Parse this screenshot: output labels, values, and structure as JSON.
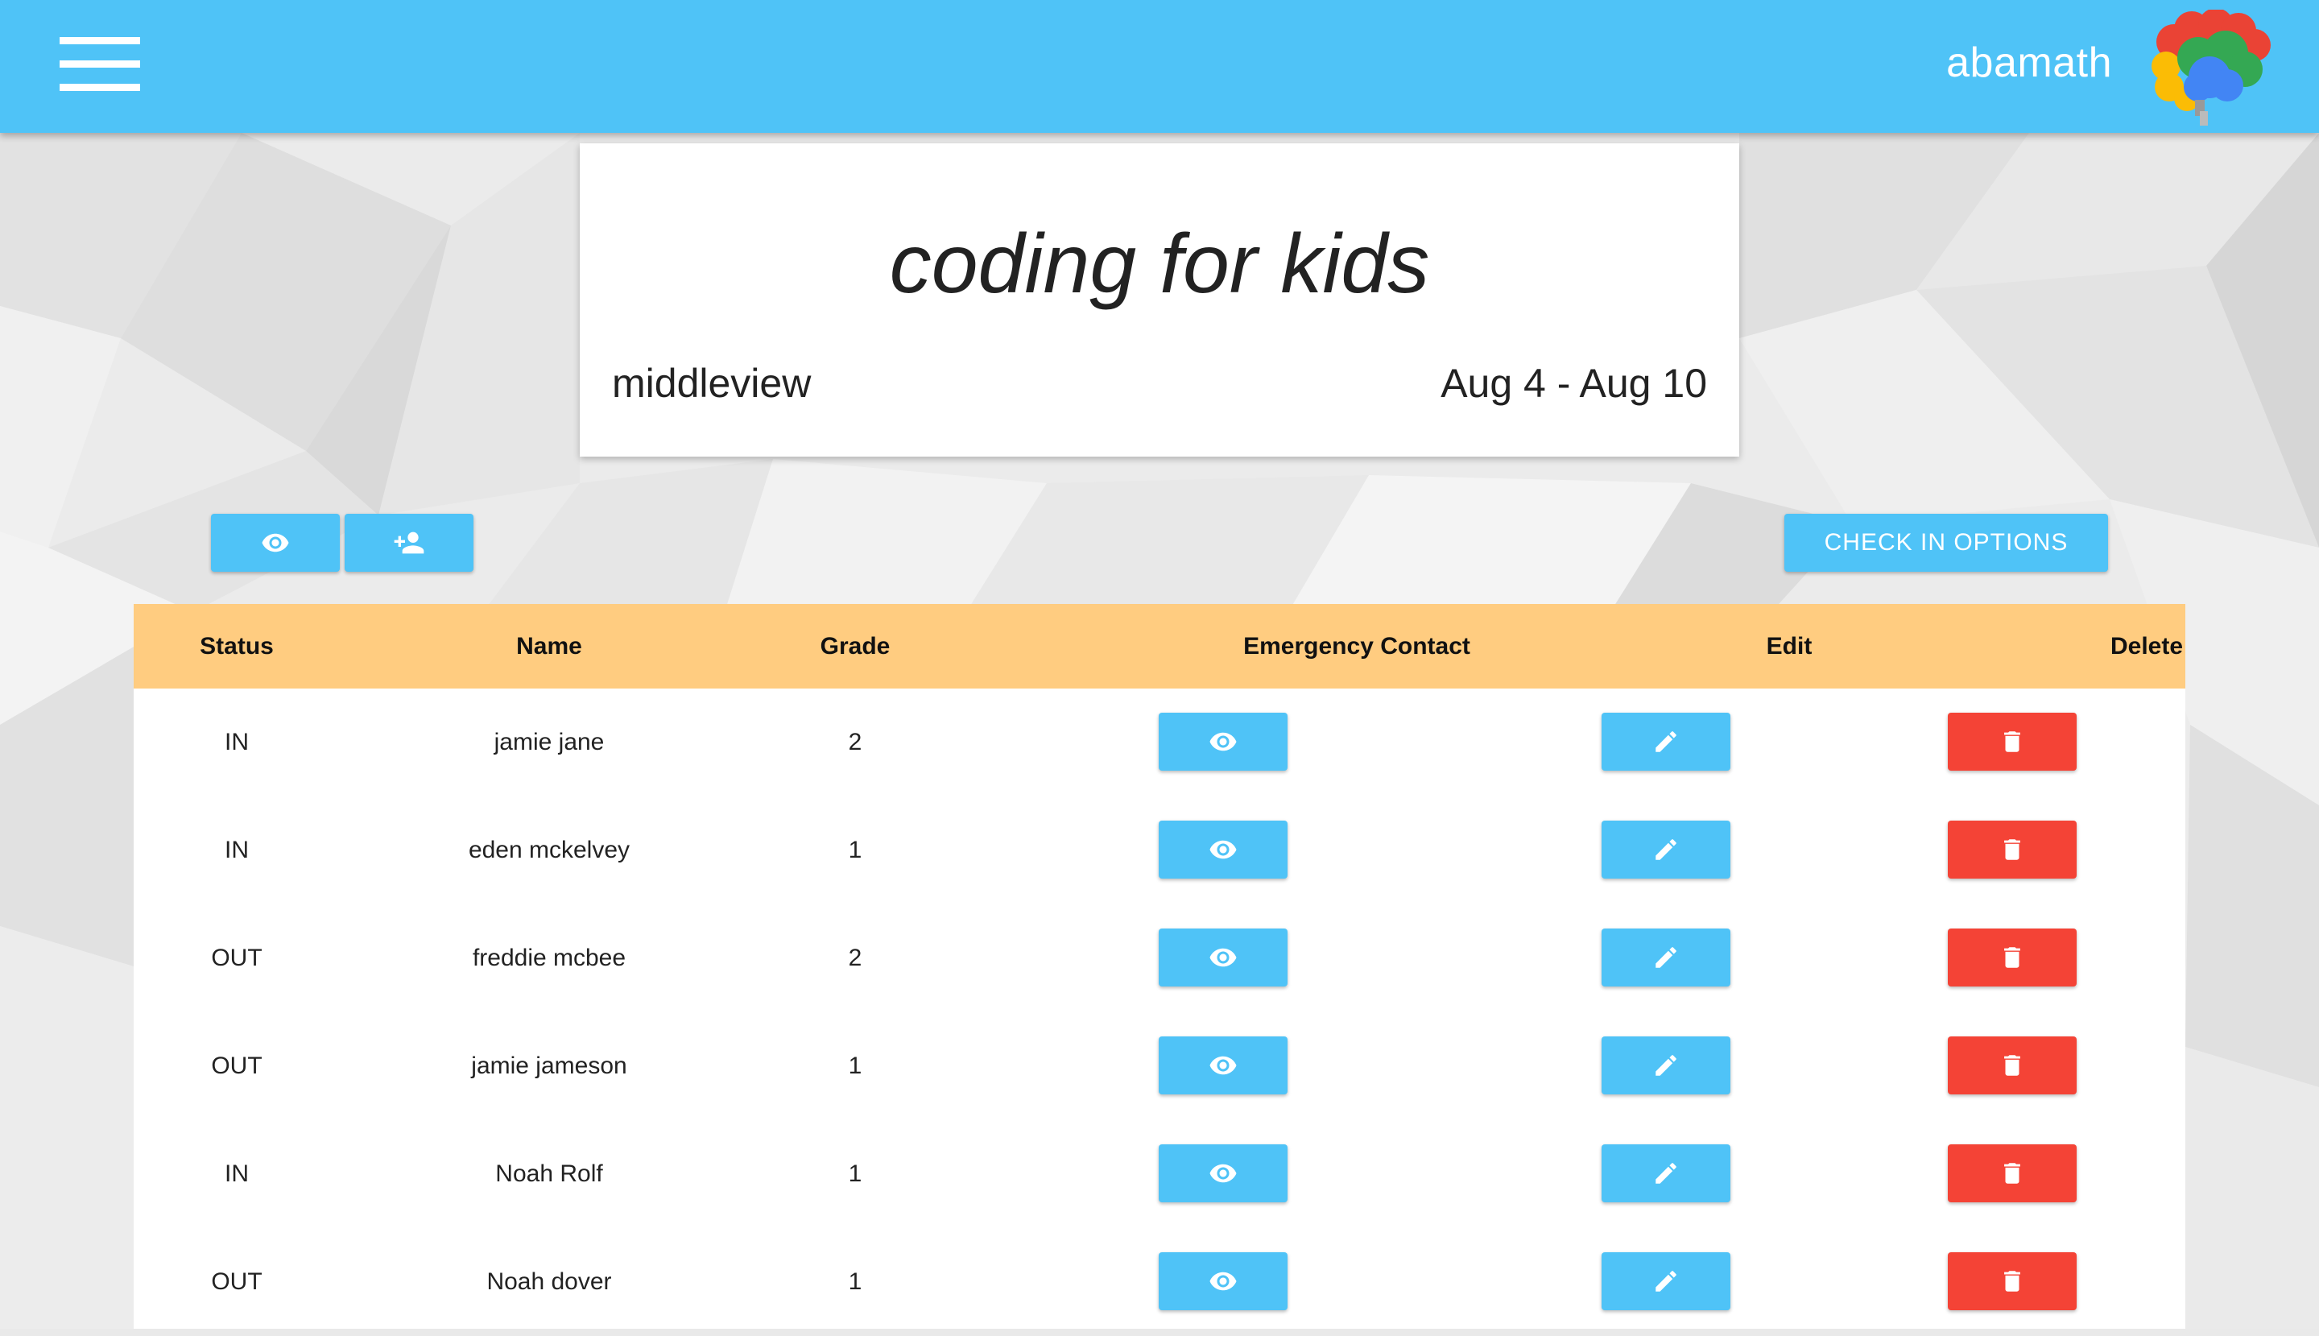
{
  "header": {
    "brand_name": "abamath",
    "menu_icon": "hamburger-menu-icon",
    "logo_icon": "brain-logo-icon"
  },
  "class_card": {
    "title": "coding for kids",
    "location": "middleview",
    "dates": "Aug 4 - Aug 10"
  },
  "toolbar": {
    "view_icon": "eye-icon",
    "add_student_icon": "person-add-icon",
    "check_in_label": "CHECK IN OPTIONS"
  },
  "table": {
    "columns": [
      "Status",
      "Name",
      "Grade",
      "Emergency Contact",
      "Edit",
      "Delete"
    ],
    "rows": [
      {
        "status": "IN",
        "name": "jamie jane",
        "grade": "2"
      },
      {
        "status": "IN",
        "name": "eden mckelvey",
        "grade": "1"
      },
      {
        "status": "OUT",
        "name": "freddie mcbee",
        "grade": "2"
      },
      {
        "status": "OUT",
        "name": "jamie jameson",
        "grade": "1"
      },
      {
        "status": "IN",
        "name": "Noah Rolf",
        "grade": "1"
      },
      {
        "status": "OUT",
        "name": "Noah dover",
        "grade": "1"
      }
    ],
    "row_icons": {
      "contact": "eye-icon",
      "edit": "pencil-icon",
      "delete": "trash-icon"
    }
  },
  "colors": {
    "primary": "#4fc3f7",
    "table_header": "#ffcc80",
    "delete": "#f44336",
    "background": "#e9e9e9"
  }
}
